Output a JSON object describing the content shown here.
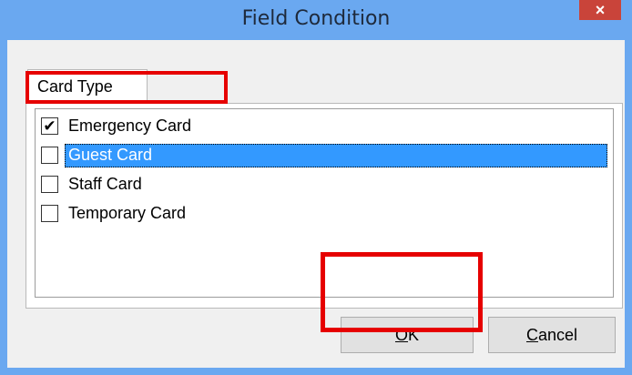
{
  "window": {
    "title": "Field Condition",
    "close_glyph": "×"
  },
  "tab": {
    "label": "Card Type"
  },
  "list": {
    "items": [
      {
        "label": "Emergency Card",
        "checked": true,
        "selected": false
      },
      {
        "label": "Guest Card",
        "checked": false,
        "selected": true
      },
      {
        "label": "Staff Card",
        "checked": false,
        "selected": false
      },
      {
        "label": "Temporary Card",
        "checked": false,
        "selected": false
      }
    ]
  },
  "buttons": {
    "ok": {
      "accel": "O",
      "rest": "K"
    },
    "cancel": {
      "accel": "C",
      "rest": "ancel"
    }
  },
  "check_glyph": "✔",
  "colors": {
    "titlebar": "#6aa8f0",
    "selection": "#3399ff",
    "highlight": "#e60000",
    "close": "#c9443a"
  }
}
